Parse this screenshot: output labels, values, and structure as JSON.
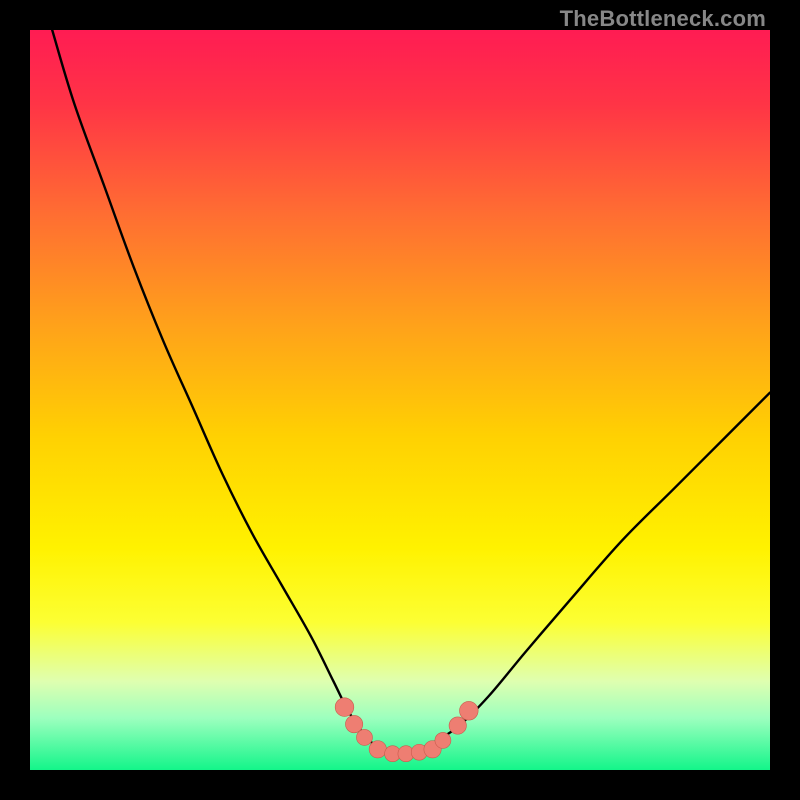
{
  "watermark": "TheBottleneck.com",
  "colors": {
    "frame": "#000000",
    "curve": "#000000",
    "marker_fill": "#ee7e72",
    "marker_stroke": "#c95b4d",
    "gradient_stops": [
      {
        "offset": 0.0,
        "color": "#ff1c53"
      },
      {
        "offset": 0.1,
        "color": "#ff3446"
      },
      {
        "offset": 0.25,
        "color": "#ff6e32"
      },
      {
        "offset": 0.4,
        "color": "#ffa21a"
      },
      {
        "offset": 0.55,
        "color": "#ffd102"
      },
      {
        "offset": 0.7,
        "color": "#fff200"
      },
      {
        "offset": 0.8,
        "color": "#fcff33"
      },
      {
        "offset": 0.88,
        "color": "#dfffb0"
      },
      {
        "offset": 0.93,
        "color": "#9cffbe"
      },
      {
        "offset": 1.0,
        "color": "#13f58a"
      }
    ]
  },
  "chart_data": {
    "type": "line",
    "title": "",
    "xlabel": "",
    "ylabel": "",
    "xlim": [
      0,
      100
    ],
    "ylim": [
      0,
      100
    ],
    "series": [
      {
        "name": "bottleneck-curve",
        "x": [
          3,
          6,
          10,
          14,
          18,
          22,
          26,
          30,
          34,
          38,
          41,
          43,
          45,
          47,
          49,
          51,
          53,
          55,
          58,
          62,
          67,
          73,
          80,
          87,
          94,
          100
        ],
        "y": [
          100,
          90,
          79,
          68,
          58,
          49,
          40,
          32,
          25,
          18,
          12,
          8,
          5,
          3,
          2,
          2,
          3,
          4,
          6,
          10,
          16,
          23,
          31,
          38,
          45,
          51
        ]
      }
    ],
    "markers": {
      "name": "bottom-cluster",
      "points": [
        {
          "x": 42.5,
          "y": 8.5,
          "r": 1.4
        },
        {
          "x": 43.8,
          "y": 6.2,
          "r": 1.3
        },
        {
          "x": 45.2,
          "y": 4.4,
          "r": 1.2
        },
        {
          "x": 47.0,
          "y": 2.8,
          "r": 1.3
        },
        {
          "x": 49.0,
          "y": 2.2,
          "r": 1.2
        },
        {
          "x": 50.8,
          "y": 2.2,
          "r": 1.2
        },
        {
          "x": 52.6,
          "y": 2.4,
          "r": 1.2
        },
        {
          "x": 54.4,
          "y": 2.8,
          "r": 1.3
        },
        {
          "x": 55.8,
          "y": 4.0,
          "r": 1.2
        },
        {
          "x": 57.8,
          "y": 6.0,
          "r": 1.3
        },
        {
          "x": 59.3,
          "y": 8.0,
          "r": 1.4
        }
      ]
    }
  }
}
